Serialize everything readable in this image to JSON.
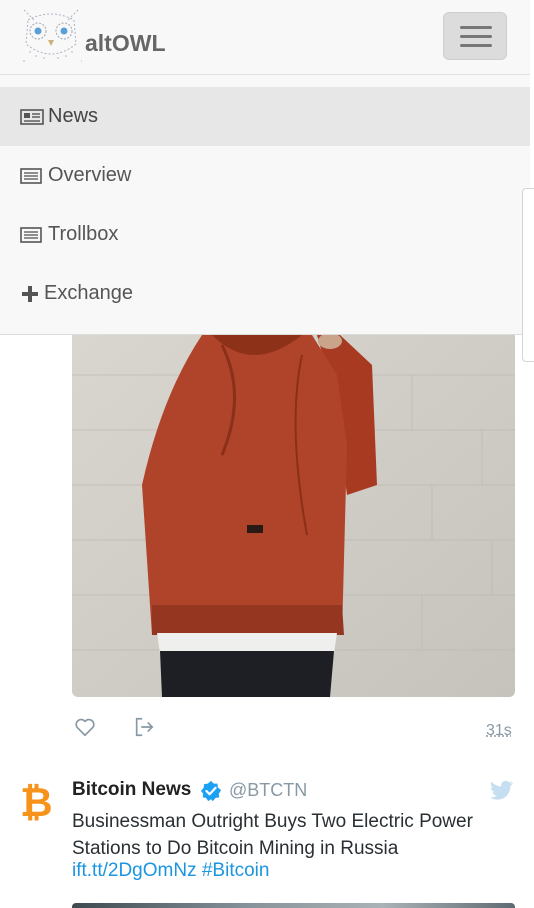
{
  "header": {
    "brand": "altOWL",
    "menu_icon": "hamburger-icon"
  },
  "nav": {
    "items": [
      {
        "label": "News",
        "icon": "newspaper-icon",
        "active": true
      },
      {
        "label": "Overview",
        "icon": "list-icon",
        "active": false
      },
      {
        "label": "Trollbox",
        "icon": "list-icon",
        "active": false
      },
      {
        "label": "Exchange",
        "icon": "plus-icon",
        "active": false
      }
    ]
  },
  "tweet1": {
    "time": "31s",
    "like_icon": "heart-icon",
    "share_icon": "share-icon"
  },
  "tweet2": {
    "author": "Bitcoin News",
    "handle": "@BTCTN",
    "text": "Businessman Outright Buys Two Electric Power Stations to Do Bitcoin Mining in Russia",
    "link": "ift.tt/2DgOmNz #Bitcoin",
    "logo": "₿"
  },
  "colors": {
    "link": "#1b95e0",
    "bitcoin": "#f7931a",
    "muted": "#8899a6"
  }
}
